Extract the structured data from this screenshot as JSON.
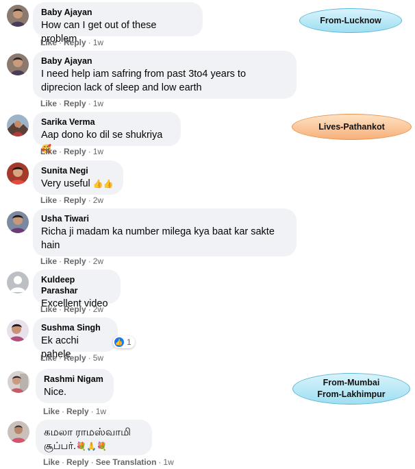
{
  "comments": [
    {
      "name": "Baby Ajayan",
      "text": "How can I get out of these problem",
      "like": "Like",
      "reply": "Reply",
      "time": "1w"
    },
    {
      "name": "Baby Ajayan",
      "text": "I need help iam safring from past 3to4 years to diprecion lack of sleep and low earth",
      "like": "Like",
      "reply": "Reply",
      "time": "1w"
    },
    {
      "name": "Sarika Verma",
      "text": "Aap dono ko dil se shukriya",
      "emoji": "🥰",
      "like": "Like",
      "reply": "Reply",
      "time": "1w"
    },
    {
      "name": "Sunita Negi",
      "text": "Very useful",
      "emoji": "👍👍",
      "like": "Like",
      "reply": "Reply",
      "time": "2w"
    },
    {
      "name": "Usha Tiwari",
      "text": "Richa ji madam ka number milega kya baat kar sakte hain",
      "like": "Like",
      "reply": "Reply",
      "time": "2w"
    },
    {
      "name": "Kuldeep Parashar",
      "text": "Excellent video",
      "like": "Like",
      "reply": "Reply",
      "time": "2w"
    },
    {
      "name": "Sushma Singh",
      "text": "Ek acchi pahele",
      "like": "Like",
      "reply": "Reply",
      "time": "5w",
      "reaction_count": "1"
    },
    {
      "name": "Rashmi Nigam",
      "text": "Nice.",
      "like": "Like",
      "reply": "Reply",
      "time": "1w"
    },
    {
      "name": "கமலா ராமஸ்வாமி",
      "text": "சூப்பர்.",
      "emoji": "💐🙏💐",
      "like": "Like",
      "reply": "Reply",
      "see_translation": "See Translation",
      "time": "1w"
    }
  ],
  "tags": {
    "lucknow": "From-Lucknow",
    "pathankot": "Lives-Pathankot",
    "mumbai": "From-Mumbai",
    "lakhimpur": "From-Lakhimpur"
  },
  "colors": {
    "bubble": "#f0f2f5",
    "meta": "#65676b",
    "like_blue": "#1877f2",
    "tag_blue": "#9fdff2",
    "tag_orange": "#f7b07a"
  },
  "icons": {
    "reaction": "like-reaction-icon",
    "avatar_default": "default-avatar-icon"
  }
}
